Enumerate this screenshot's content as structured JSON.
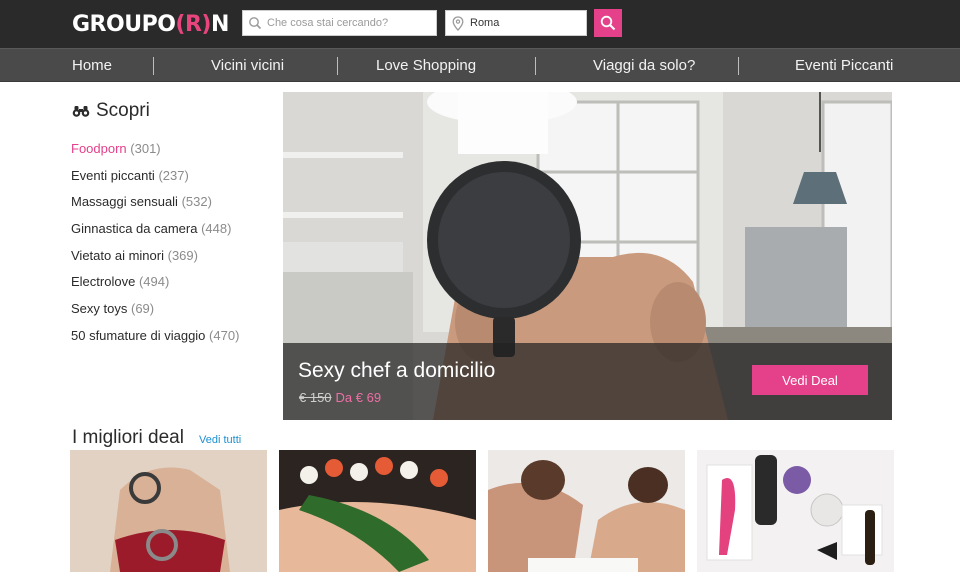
{
  "header": {
    "logo_left": "GROUP",
    "logo_mid": "O",
    "logo_r": "R",
    "logo_n": "N",
    "search_placeholder": "Che cosa stai cercando?",
    "location_value": "Roma"
  },
  "nav": {
    "items": [
      {
        "label": "Home"
      },
      {
        "label": "Vicini vicini"
      },
      {
        "label": "Love Shopping"
      },
      {
        "label": "Viaggi da solo?"
      },
      {
        "label": "Eventi Piccanti"
      }
    ]
  },
  "sidebar": {
    "title": "Scopri",
    "categories": [
      {
        "label": "Foodporn",
        "count": "(301)"
      },
      {
        "label": "Eventi piccanti",
        "count": "(237)"
      },
      {
        "label": "Massaggi sensuali",
        "count": "(532)"
      },
      {
        "label": "Ginnastica da camera",
        "count": "(448)"
      },
      {
        "label": "Vietato ai minori",
        "count": "(369)"
      },
      {
        "label": "Electrolove",
        "count": "(494)"
      },
      {
        "label": "Sexy toys",
        "count": "(69)"
      },
      {
        "label": "50 sfumature di viaggio",
        "count": "(470)"
      }
    ]
  },
  "hero": {
    "title": "Sexy chef a domicilio",
    "old_price": "€ 150",
    "new_price": "Da € 69",
    "cta": "Vedi Deal"
  },
  "best": {
    "title": "I migliori deal",
    "see_all": "Vedi tutti"
  },
  "colors": {
    "accent": "#e5418a",
    "header_bg": "#2a2a2a",
    "nav_bg": "#4a4a4a",
    "link_blue": "#1d8fcf"
  }
}
